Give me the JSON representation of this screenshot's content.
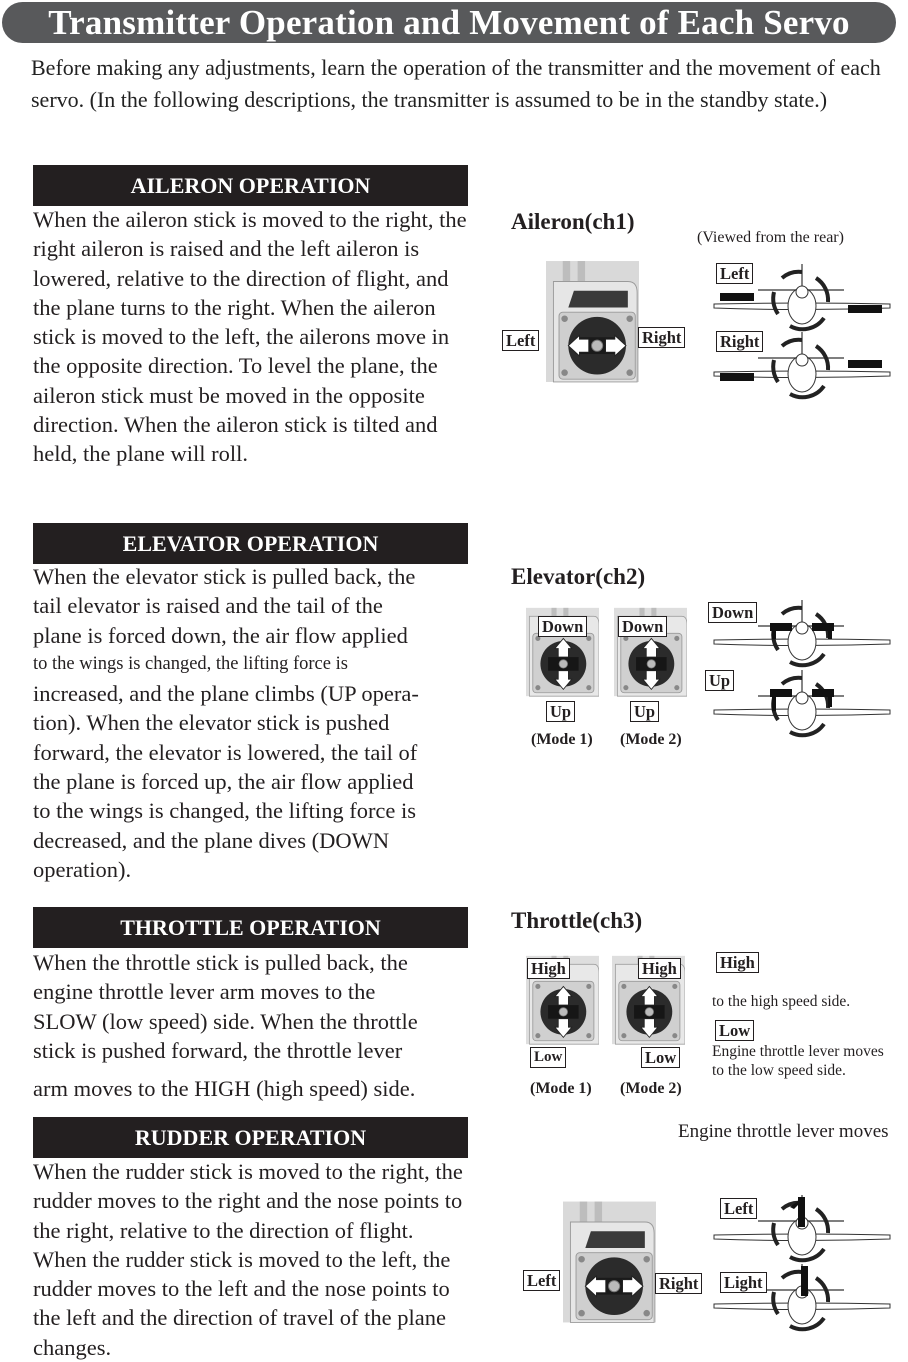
{
  "header": {
    "title": "Transmitter Operation and Movement of Each Servo"
  },
  "intro": "Before making any adjustments, learn the operation of the transmitter and the movement of each servo. (In the following descriptions, the transmitter is assumed to be in the standby state.)",
  "sections": {
    "aileron": {
      "heading": "AILERON OPERATION",
      "body": "When the aileron stick is moved to the right, the right aileron is raised and the left aileron is lowered, relative to the direction of flight, and the plane turns to the right. When the aileron stick is moved to the left, the ailerons move in the opposite direction. To level the plane, the aileron stick must be moved in the opposite direction. When the aileron stick is tilted and held, the plane will roll.",
      "diagram": {
        "title": "Aileron(ch1)",
        "view_note": "(Viewed from the rear)",
        "stick_left": "Left",
        "stick_right": "Right",
        "plane_top": "Left",
        "plane_bottom": "Right"
      }
    },
    "elevator": {
      "heading": "ELEVATOR OPERATION",
      "body_lines": [
        "When the elevator stick is pulled back, the",
        "tail elevator is raised and the tail of the",
        "plane is forced down, the air flow applied",
        "to the wings is changed, the lifting force is",
        "increased, and the plane climbs (UP opera-",
        "tion). When the elevator stick is pushed",
        "forward, the elevator is lowered, the tail of",
        "the plane is forced up, the air flow applied",
        "to the wings is changed, the lifting force is",
        "decreased, and the plane dives (DOWN",
        "operation)."
      ],
      "diagram": {
        "title": "Elevator(ch2)",
        "mode1": {
          "top": "Down",
          "bottom": "Up",
          "caption": "(Mode 1)"
        },
        "mode2": {
          "top": "Down",
          "bottom": "Up",
          "caption": "(Mode 2)"
        },
        "plane_top": "Down",
        "plane_bottom": "Up"
      }
    },
    "throttle": {
      "heading": "THROTTLE OPERATION",
      "body_lines": [
        "When the throttle stick is pulled back, the",
        "engine throttle lever arm moves to the",
        "SLOW (low speed) side. When the throttle",
        "stick is pushed forward, the throttle lever",
        "arm moves to the HIGH (high speed) side."
      ],
      "diagram": {
        "title": "Throttle(ch3)",
        "mode1": {
          "top": "High",
          "bottom": "Low",
          "caption": "(Mode 1)"
        },
        "mode2": {
          "top": "High",
          "bottom": "Low",
          "caption": "(Mode 2)"
        },
        "high_label": "High",
        "high_note": "to the high speed side.",
        "low_label": "Low",
        "low_note_1": "Engine throttle lever moves",
        "low_note_2": "to the low speed side.",
        "stray_note": "Engine throttle lever moves"
      }
    },
    "rudder": {
      "heading": "RUDDER OPERATION",
      "body": "When the rudder stick is moved to the right, the rudder moves to the right and the nose points to the right, relative to the direction of flight. When the rudder stick is moved to the left, the rudder moves to the left and the nose points to the left and the direction of travel of the plane changes.",
      "diagram": {
        "stick_left": "Left",
        "stick_right": "Right",
        "plane_top": "Left",
        "plane_bottom": "Light"
      }
    }
  }
}
